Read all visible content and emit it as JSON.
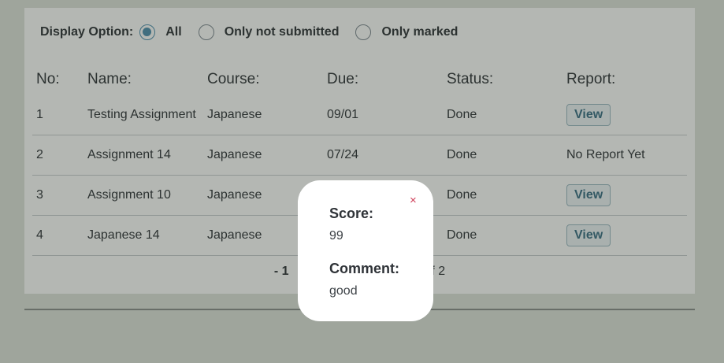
{
  "filter": {
    "label": "Display Option:",
    "options": [
      {
        "label": "All",
        "checked": true
      },
      {
        "label": "Only not submitted",
        "checked": false
      },
      {
        "label": "Only marked",
        "checked": false
      }
    ]
  },
  "table": {
    "headers": {
      "no": "No:",
      "name": "Name:",
      "course": "Course:",
      "due": "Due:",
      "status": "Status:",
      "report": "Report:"
    },
    "rows": [
      {
        "no": "1",
        "name": "Testing Assignment",
        "course": "Japanese",
        "due": "09/01",
        "status": "Done",
        "report": "View",
        "report_is_button": true
      },
      {
        "no": "2",
        "name": "Assignment 14",
        "course": "Japanese",
        "due": "07/24",
        "status": "Done",
        "report": "No Report Yet",
        "report_is_button": false
      },
      {
        "no": "3",
        "name": "Assignment 10",
        "course": "Japanese",
        "due": "",
        "status": "Done",
        "report": "View",
        "report_is_button": true
      },
      {
        "no": "4",
        "name": "Japanese 14",
        "course": "Japanese",
        "due": "",
        "status": "Done",
        "report": "View",
        "report_is_button": true
      }
    ]
  },
  "pager": {
    "left_text": "- 1",
    "right_text": "of 2"
  },
  "popup": {
    "close_glyph": "×",
    "score_label": "Score:",
    "score_value": "99",
    "comment_label": "Comment:",
    "comment_value": "good"
  }
}
